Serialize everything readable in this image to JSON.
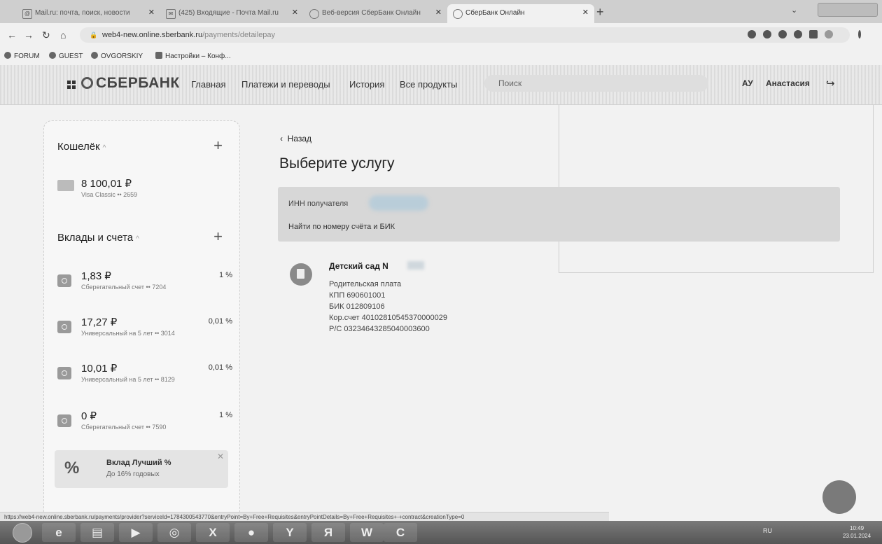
{
  "browser": {
    "tabs": [
      {
        "title": "Mail.ru: почта, поиск, новости"
      },
      {
        "title": "(425) Входящие - Почта Mail.ru"
      },
      {
        "title": "Веб-версия СберБанк Онлайн"
      },
      {
        "title": "СберБанк Онлайн"
      }
    ],
    "url_host": "web4-new.online.sberbank.ru",
    "url_path": "/payments/detailepay",
    "bookmarks": [
      {
        "label": "FORUM"
      },
      {
        "label": "GUEST"
      },
      {
        "label": "OVGORSKIY"
      },
      {
        "label": "Настройки – Конф..."
      }
    ]
  },
  "header": {
    "logo": "СБЕРБАНК",
    "nav": [
      {
        "label": "Главная"
      },
      {
        "label": "Платежи и переводы"
      },
      {
        "label": "История"
      },
      {
        "label": "Все продукты"
      }
    ],
    "search_placeholder": "Поиск",
    "user_initials": "АУ",
    "user_name": "Анастасия"
  },
  "sidebar": {
    "wallet_title": "Кошелёк",
    "wallet_card": {
      "amount": "8 100,01 ₽",
      "subtitle": "Visa Classic •• 2659"
    },
    "deposits_title": "Вклады и счета",
    "accounts": [
      {
        "amount": "1,83 ₽",
        "subtitle": "Сберегательный счет •• 7204",
        "rate": "1 %"
      },
      {
        "amount": "17,27 ₽",
        "subtitle": "Универсальный на 5 лет •• 3014",
        "rate": "0,01 %"
      },
      {
        "amount": "10,01 ₽",
        "subtitle": "Универсальный на 5 лет •• 8129",
        "rate": "0,01 %"
      },
      {
        "amount": "0 ₽",
        "subtitle": "Сберегательный счет •• 7590",
        "rate": "1 %"
      }
    ],
    "promo": {
      "title": "Вклад Лучший %",
      "subtitle": "До 16% годовых",
      "image_text": "%"
    }
  },
  "main": {
    "back_label": "Назад",
    "page_title": "Выберите услугу",
    "inn_label": "ИНН получателя",
    "find_by_account": "Найти по номеру счёта и БИК",
    "provider": {
      "name": "Детский сад N",
      "lines": [
        "Родительская плата",
        "КПП 690601001",
        "БИК 012809106",
        "Кор.счет 40102810545370000029",
        "Р/С 03234643285040003600"
      ]
    }
  },
  "status_url": "https://web4-new.online.sberbank.ru/payments/provider?serviceId=1784300543770&entryPoint=By+Free+Requisites&entryPointDetails=By+Free+Requisites+-+contract&creationType=0",
  "taskbar": {
    "lang": "RU",
    "time": "10:49",
    "date": "23.01.2024"
  }
}
